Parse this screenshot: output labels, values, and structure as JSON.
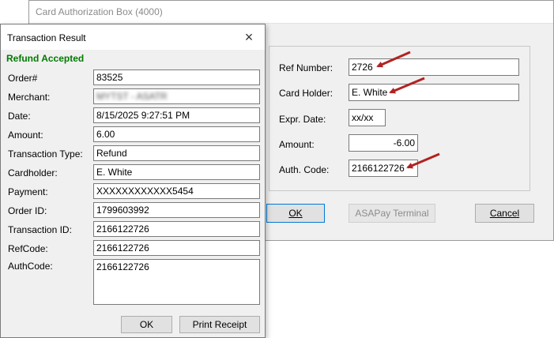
{
  "card_auth_window": {
    "title": "Card Authorization Box (4000)",
    "fields": {
      "ref_number": {
        "label": "Ref Number:",
        "value": "2726"
      },
      "card_holder": {
        "label": "Card Holder:",
        "value": "E. White"
      },
      "expr_date": {
        "label": "Expr. Date:",
        "value": "xx/xx"
      },
      "amount": {
        "label": "Amount:",
        "value": "-6.00"
      },
      "auth_code": {
        "label": "Auth. Code:",
        "value": "2166122726"
      }
    },
    "buttons": {
      "ok": "OK",
      "terminal": "ASAPay Terminal",
      "cancel": "Cancel"
    }
  },
  "transaction_result": {
    "title": "Transaction Result",
    "close_icon": "×",
    "status": "Refund Accepted",
    "status_color": "#007a00",
    "rows": [
      {
        "label": "Order#",
        "value": "83525"
      },
      {
        "label": "Merchant:",
        "value": "MYTST - ASATR"
      },
      {
        "label": "Date:",
        "value": "8/15/2025 9:27:51 PM"
      },
      {
        "label": "Amount:",
        "value": "6.00"
      },
      {
        "label": "Transaction Type:",
        "value": "Refund"
      },
      {
        "label": "Cardholder:",
        "value": "E. White"
      },
      {
        "label": "Payment:",
        "value": "XXXXXXXXXXXX5454"
      },
      {
        "label": "Order ID:",
        "value": "1799603992"
      },
      {
        "label": "Transaction ID:",
        "value": "2166122726"
      },
      {
        "label": "RefCode:",
        "value": "2166122726"
      }
    ],
    "authcode": {
      "label": "AuthCode:",
      "value": "2166122726"
    },
    "buttons": {
      "ok": "OK",
      "print": "Print Receipt"
    }
  },
  "annotation_color": "#b22222"
}
